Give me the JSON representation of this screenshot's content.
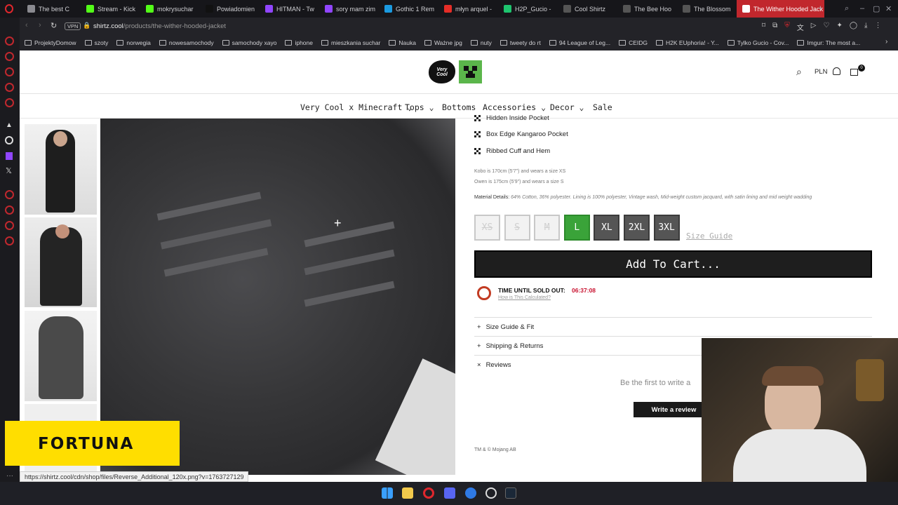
{
  "tabs": [
    {
      "label": "The best C",
      "color": "#8a8a90"
    },
    {
      "label": "Stream - Kick",
      "color": "#53fc18"
    },
    {
      "label": "mokrysuchar",
      "color": "#53fc18"
    },
    {
      "label": "Powiadomien",
      "color": "#111"
    },
    {
      "label": "HITMAN - Tw",
      "color": "#9146ff"
    },
    {
      "label": "sory mam zim",
      "color": "#9146ff"
    },
    {
      "label": "Gothic 1 Rem",
      "color": "#1b9ae0"
    },
    {
      "label": "młyn arquel -",
      "color": "#e52d27"
    },
    {
      "label": "H2P_Gucio -",
      "color": "#1ec46e"
    },
    {
      "label": "Cool Shirtz",
      "color": "#555"
    },
    {
      "label": "The Bee Hoo",
      "color": "#555"
    },
    {
      "label": "The Blossom",
      "color": "#555"
    },
    {
      "label": "The Wither Hooded Jack",
      "color": "#fff"
    }
  ],
  "address": {
    "vpn": "VPN",
    "domain": "shirtz.cool",
    "path": "/products/the-wither-hooded-jacket"
  },
  "bookmarks": [
    "ProjektyDomow",
    "szoty",
    "norwegia",
    "nowesamochody",
    "samochody xayo",
    "iphone",
    "mieszkania suchar",
    "Nauka",
    "Ważne jpg",
    "nuty",
    "tweety do rt",
    "94 League of Leg...",
    "CEIDG",
    "H2K EUphoria! - Y...",
    "Tylko Gucio - Cov...",
    "Imgur: The most a..."
  ],
  "site": {
    "logo_text": "Very Cool",
    "currency": "PLN",
    "cart_count": "0"
  },
  "nav": [
    "Very Cool x Minecraft",
    "Tops",
    "Bottoms",
    "Accessories",
    "Decor",
    "Sale"
  ],
  "features": [
    "Hidden Inside Pocket",
    "Box Edge Kangaroo Pocket",
    "Ribbed Cuff and Hem"
  ],
  "model_info": [
    "Kobo is 170cm (5'7\") and wears a size XS",
    "Owen is 175cm (5'9\") and wears a size S"
  ],
  "material": {
    "label": "Material Details:",
    "text": "64% Cotton, 36% polyester. Lining is 100% polyester, Vintage wash, Mid-weight custom jacquard, with satin lining and mid weight wadding"
  },
  "sizes": [
    {
      "label": "XS",
      "state": "dis"
    },
    {
      "label": "S",
      "state": "dis"
    },
    {
      "label": "M",
      "state": "dis"
    },
    {
      "label": "L",
      "state": "sel"
    },
    {
      "label": "XL",
      "state": "avl"
    },
    {
      "label": "2XL",
      "state": "avl"
    },
    {
      "label": "3XL",
      "state": "avl"
    }
  ],
  "size_guide": "Size Guide",
  "add_to_cart": "Add To Cart...",
  "timer": {
    "label": "TIME UNTIL SOLD OUT:",
    "value": "06:37:08",
    "link": "How is This Calculated?"
  },
  "accordions": [
    {
      "sign": "+",
      "label": "Size Guide & Fit"
    },
    {
      "sign": "+",
      "label": "Shipping & Returns"
    },
    {
      "sign": "×",
      "label": "Reviews"
    }
  ],
  "reviews": {
    "prompt": "Be the first to write a",
    "button": "Write a review"
  },
  "footer": "TM & © Mojang AB",
  "ad": {
    "text": "FORTUNA"
  },
  "status_url": "https://shirtz.cool/cdn/shop/files/Reverse_Additional_120x.png?v=1763727129"
}
